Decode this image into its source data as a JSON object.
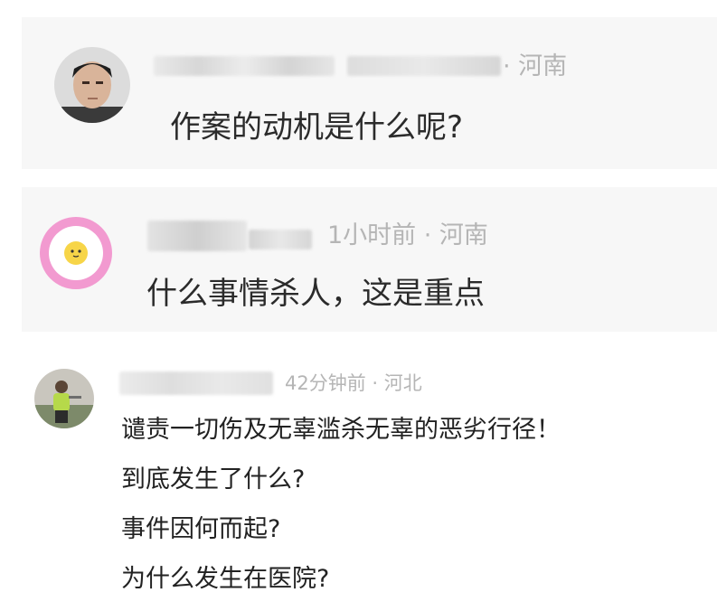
{
  "comments": [
    {
      "location_meta": "· 河南",
      "text": "作案的动机是什么呢?"
    },
    {
      "time_location_meta": "1小时前 · 河南",
      "text": "什么事情杀人，这是重点"
    },
    {
      "time_location_meta": "42分钟前 · 河北",
      "lines": [
        "谴责一切伤及无辜滥杀无辜的恶劣行径！",
        "到底发生了什么?",
        "事件因何而起?",
        "为什么发生在医院?"
      ]
    }
  ],
  "colors": {
    "meta_text": "#b5b5b5",
    "card_background": "#f7f7f7",
    "egg_avatar_ring": "#f29ad0"
  }
}
